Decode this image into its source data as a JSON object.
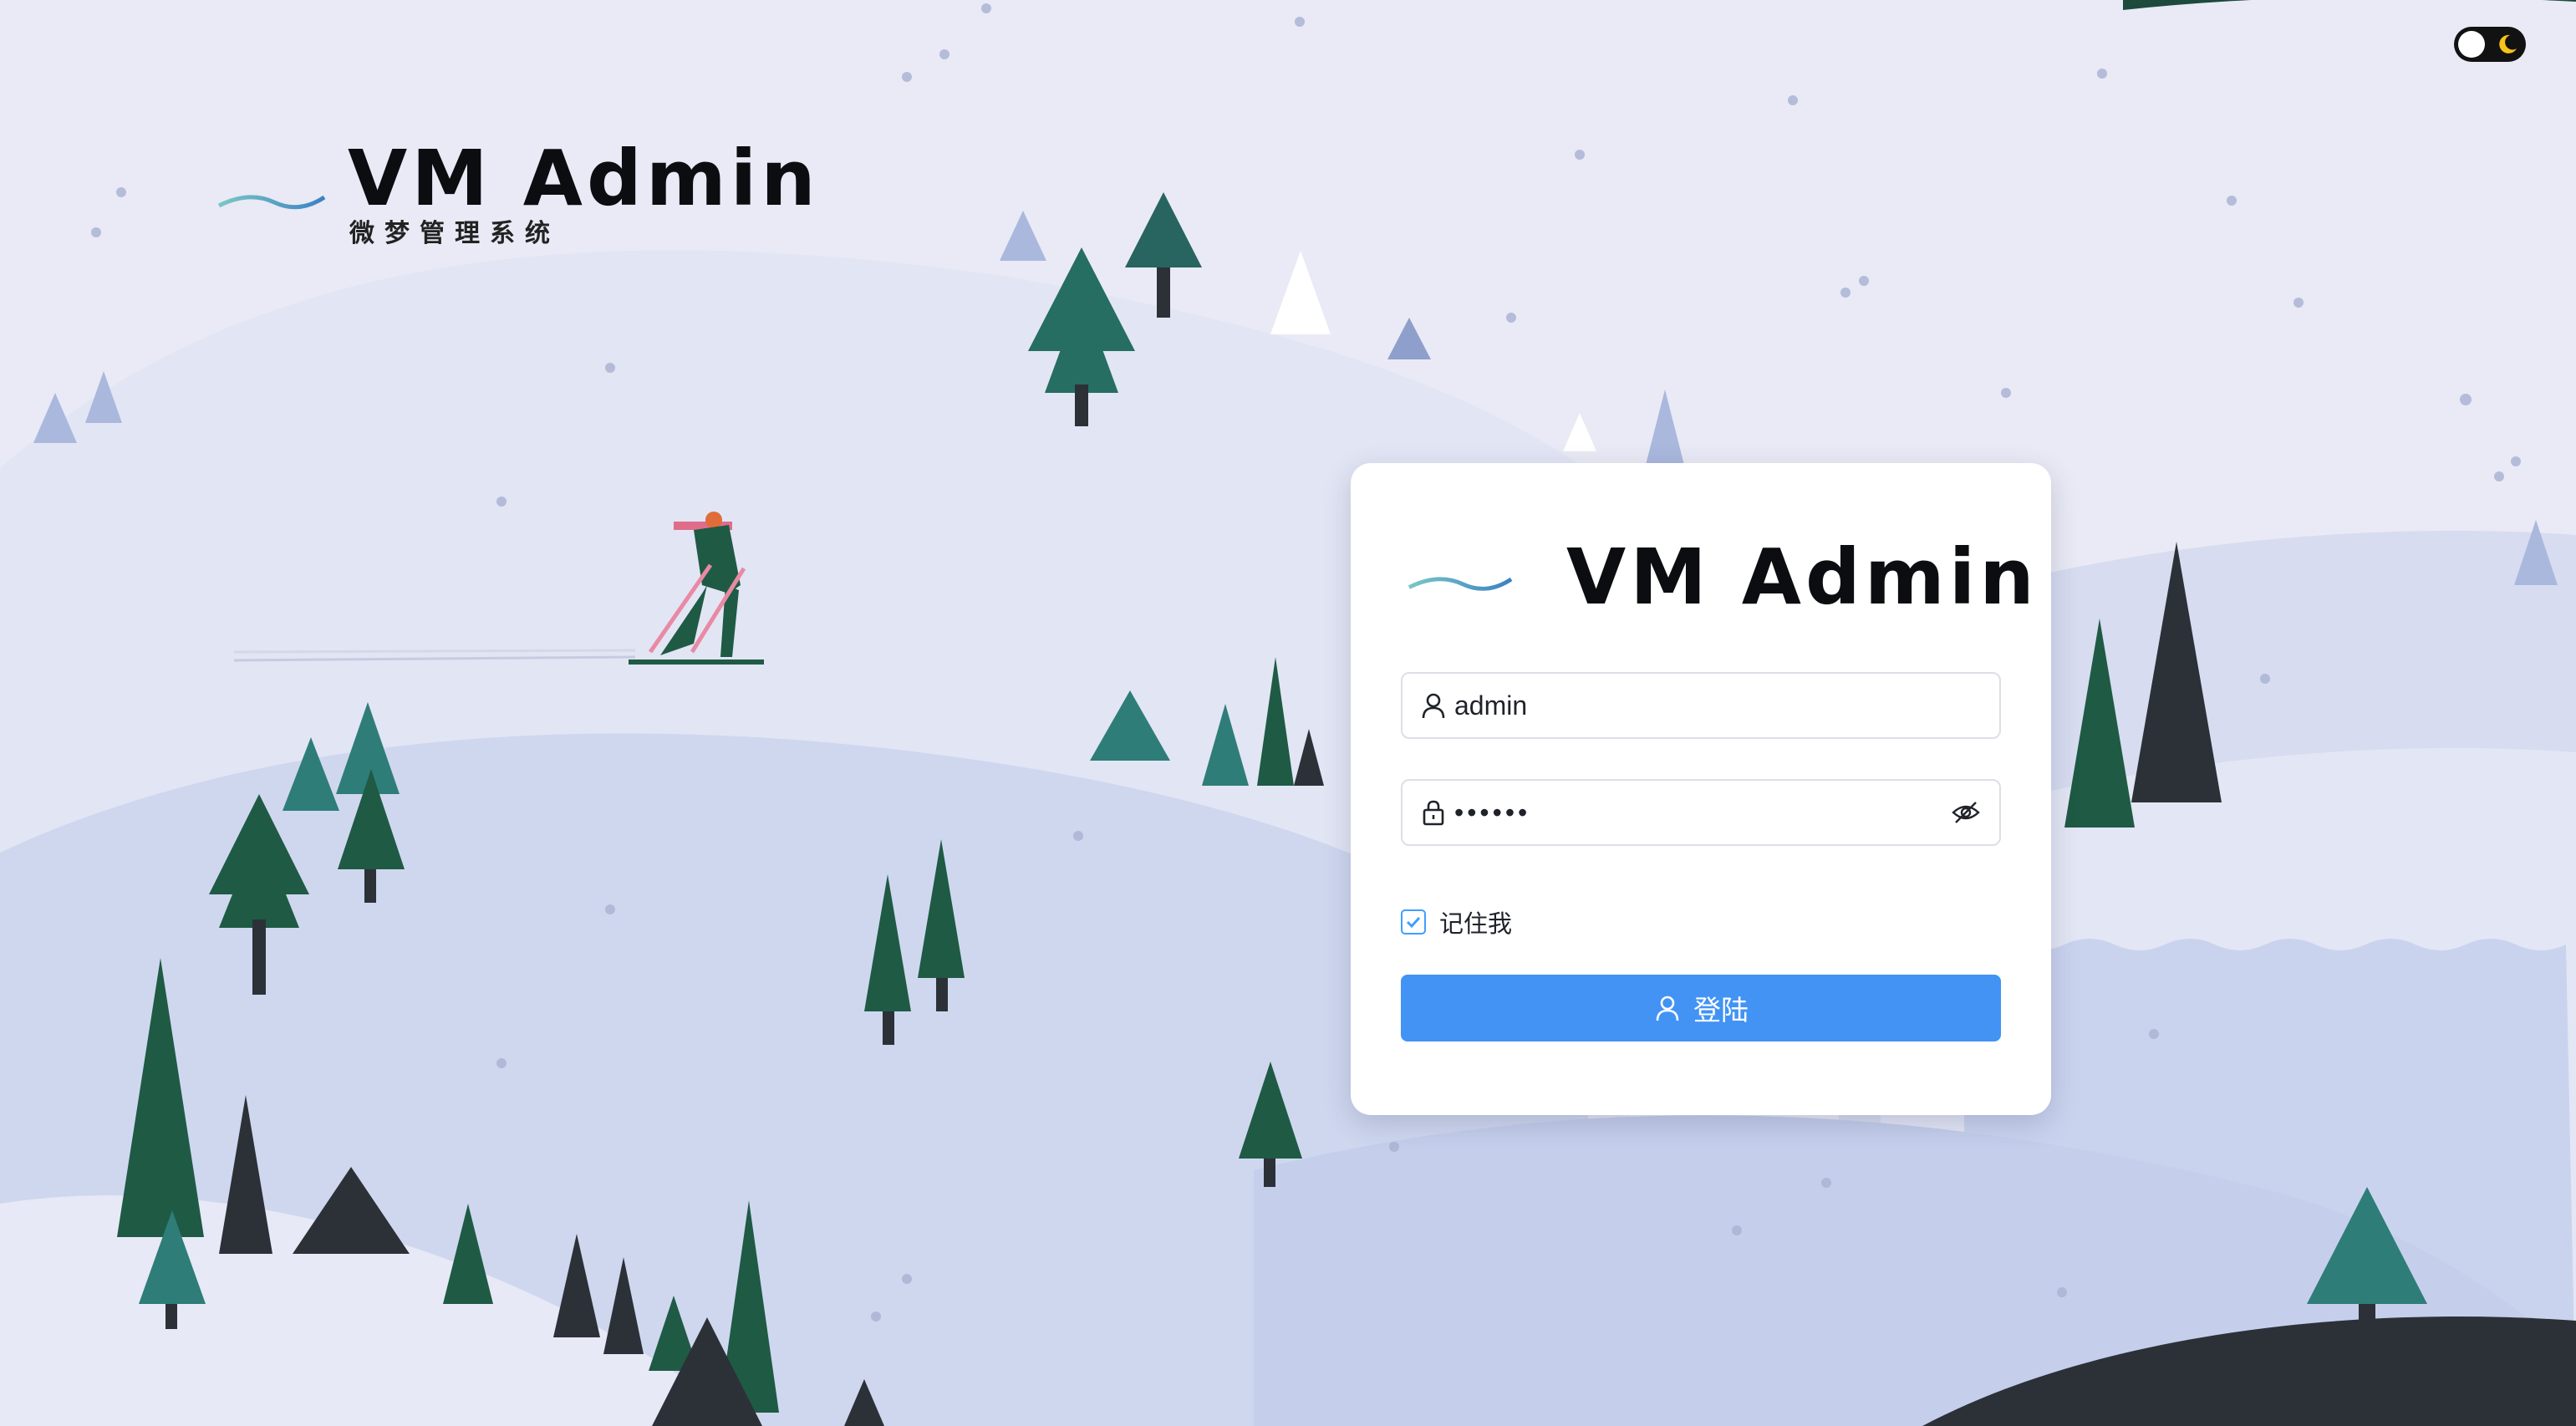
{
  "header": {
    "brand_title": "VM Admin",
    "brand_subtitle": "微梦管理系统",
    "logo_icon": "sound-wave-logo-icon"
  },
  "theme_toggle": {
    "mode": "light",
    "icon": "moon-icon"
  },
  "login_card": {
    "title": "VM Admin",
    "username": {
      "value": "admin",
      "icon": "user-icon"
    },
    "password": {
      "value": "••••••",
      "icon": "lock-icon",
      "toggle_icon": "eye-off-icon"
    },
    "remember_me": {
      "label": "记住我",
      "checked": true
    },
    "submit": {
      "label": "登陆",
      "icon": "user-icon"
    }
  },
  "colors": {
    "primary": "#4293f4",
    "checkbox": "#409eff",
    "tree_dark_green": "#1f5a45",
    "tree_teal": "#2f7d78",
    "snow_light": "#d9def2",
    "background": "#e9eaf5"
  }
}
